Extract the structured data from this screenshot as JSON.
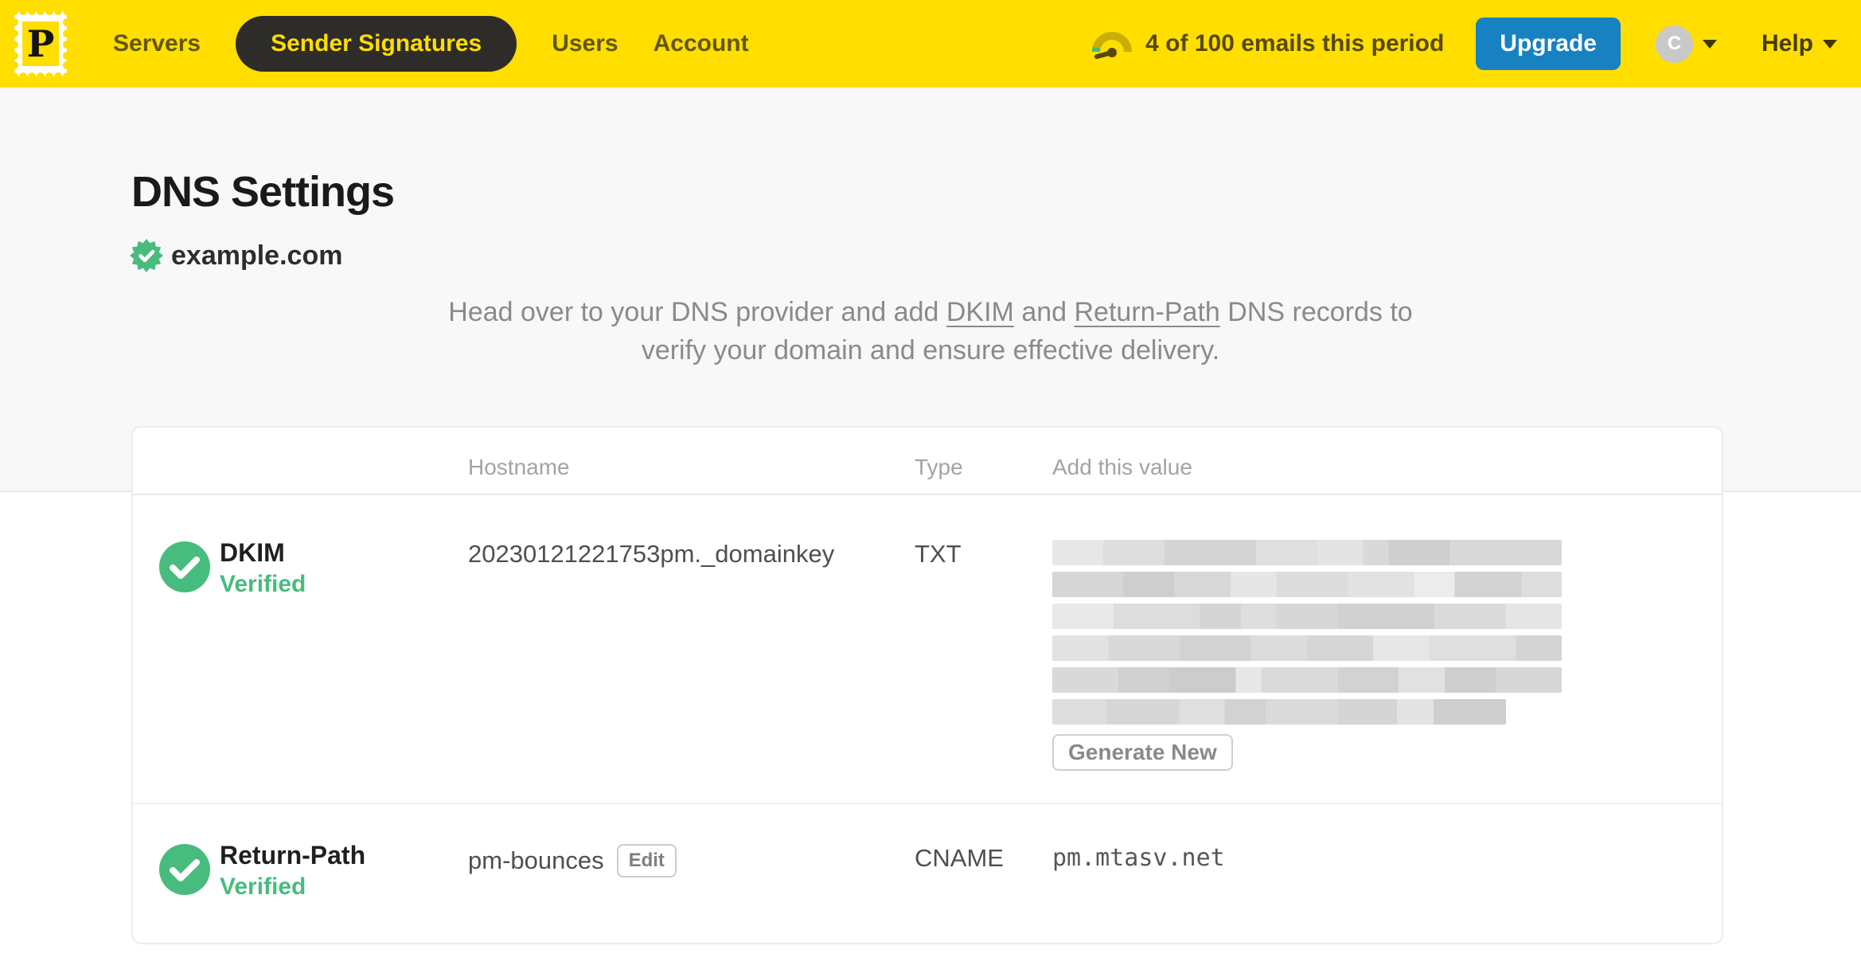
{
  "colors": {
    "brand_yellow": "#FFDE00",
    "nav_pill_bg": "#2e2c29",
    "upgrade_blue": "#1781C2",
    "verified_green": "#47BC7E",
    "page_bg_gray": "#F8F8F8"
  },
  "nav": {
    "logo_letter": "P",
    "items": [
      {
        "label": "Servers",
        "active": false
      },
      {
        "label": "Sender Signatures",
        "active": true
      },
      {
        "label": "Users",
        "active": false
      },
      {
        "label": "Account",
        "active": false
      }
    ],
    "usage_text": "4 of 100 emails this period",
    "upgrade_label": "Upgrade",
    "avatar_initial": "C",
    "help_label": "Help"
  },
  "page": {
    "title": "DNS Settings",
    "domain": "example.com",
    "description": {
      "part1": "Head over to your DNS provider and add ",
      "link_dkim": "DKIM",
      "part2": " and ",
      "link_return_path": "Return-Path",
      "part3": " DNS records to verify your domain and ensure effective delivery."
    }
  },
  "table": {
    "headers": {
      "hostname": "Hostname",
      "type": "Type",
      "value": "Add this value"
    },
    "rows": [
      {
        "name": "DKIM",
        "status": "Verified",
        "hostname": "20230121221753pm._domainkey",
        "type": "TXT",
        "value_redacted": true,
        "redacted_lines": 6,
        "value_action": "Generate New"
      },
      {
        "name": "Return-Path",
        "status": "Verified",
        "hostname": "pm-bounces",
        "hostname_action": "Edit",
        "type": "CNAME",
        "value": "pm.mtasv.net"
      }
    ]
  }
}
